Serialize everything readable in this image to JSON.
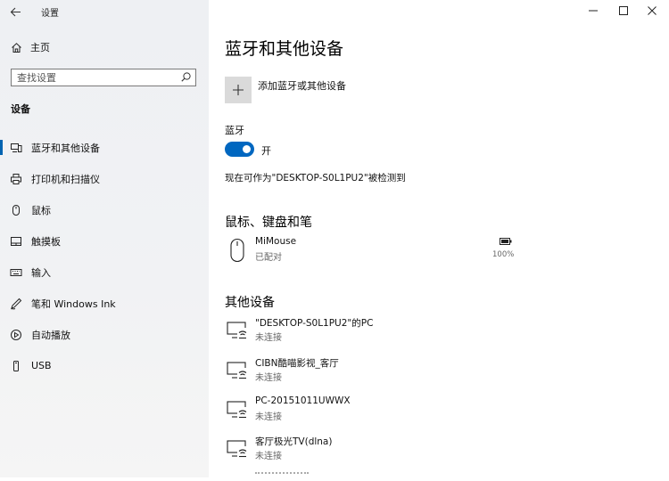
{
  "window": {
    "title": "设置",
    "back_icon": "back-arrow-icon",
    "controls": [
      "minimize-icon",
      "maximize-icon",
      "close-icon"
    ]
  },
  "sidebar": {
    "home_label": "主页",
    "search_placeholder": "查找设置",
    "section_heading": "设备",
    "items": [
      {
        "label": "蓝牙和其他设备",
        "icon": "bluetooth-devices-icon",
        "active": true
      },
      {
        "label": "打印机和扫描仪",
        "icon": "printer-icon",
        "active": false
      },
      {
        "label": "鼠标",
        "icon": "mouse-icon",
        "active": false
      },
      {
        "label": "触摸板",
        "icon": "touchpad-icon",
        "active": false
      },
      {
        "label": "输入",
        "icon": "keyboard-icon",
        "active": false
      },
      {
        "label": "笔和 Windows Ink",
        "icon": "pen-icon",
        "active": false
      },
      {
        "label": "自动播放",
        "icon": "autoplay-icon",
        "active": false
      },
      {
        "label": "USB",
        "icon": "usb-icon",
        "active": false
      }
    ]
  },
  "main": {
    "title": "蓝牙和其他设备",
    "add_device_label": "添加蓝牙或其他设备",
    "bluetooth_label": "蓝牙",
    "bluetooth_state": "开",
    "bluetooth_on": true,
    "discoverable_text": "现在可作为\"DESKTOP-S0L1PU2\"被检测到",
    "mouse_section": {
      "title": "鼠标、键盘和笔",
      "devices": [
        {
          "name": "MiMouse",
          "status": "已配对",
          "battery": "100%",
          "battery_level": 1.0
        }
      ]
    },
    "other_section": {
      "title": "其他设备",
      "devices": [
        {
          "name": "\"DESKTOP-S0L1PU2\"的PC",
          "status": "未连接"
        },
        {
          "name": "CIBN酷喵影视_客厅",
          "status": "未连接"
        },
        {
          "name": "PC-20151011UWWX",
          "status": "未连接"
        },
        {
          "name": "客厅极光TV(dlna)",
          "status": "未连接"
        }
      ]
    }
  },
  "colors": {
    "accent": "#0067c0",
    "sidebar_bg": "#f0f1f3"
  }
}
